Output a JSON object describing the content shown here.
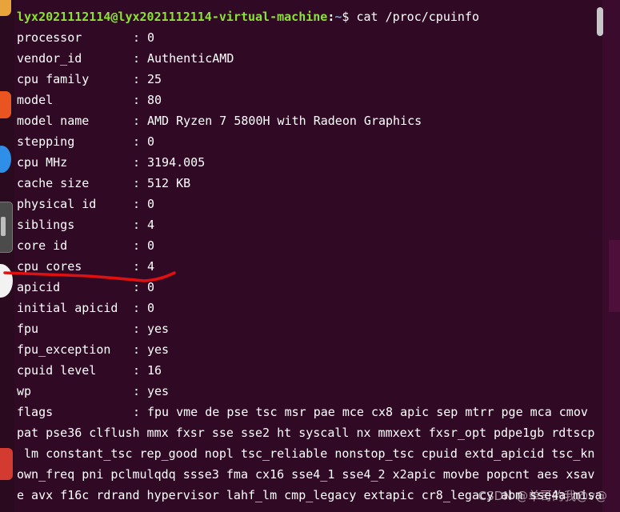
{
  "prompt": {
    "user_host": "lyx2021112114@lyx2021112114-virtual-machine",
    "sep": ":",
    "path": "~",
    "dollar": "$",
    "command": "cat /proc/cpuinfo"
  },
  "fields": [
    {
      "key": "processor",
      "value": "0"
    },
    {
      "key": "vendor_id",
      "value": "AuthenticAMD"
    },
    {
      "key": "cpu family",
      "value": "25"
    },
    {
      "key": "model",
      "value": "80"
    },
    {
      "key": "model name",
      "value": "AMD Ryzen 7 5800H with Radeon Graphics"
    },
    {
      "key": "stepping",
      "value": "0"
    },
    {
      "key": "cpu MHz",
      "value": "3194.005"
    },
    {
      "key": "cache size",
      "value": "512 KB"
    },
    {
      "key": "physical id",
      "value": "0"
    },
    {
      "key": "siblings",
      "value": "4"
    },
    {
      "key": "core id",
      "value": "0"
    },
    {
      "key": "cpu cores",
      "value": "4"
    },
    {
      "key": "apicid",
      "value": "0"
    },
    {
      "key": "initial apicid",
      "value": "0"
    },
    {
      "key": "fpu",
      "value": "yes"
    },
    {
      "key": "fpu_exception",
      "value": "yes"
    },
    {
      "key": "cpuid level",
      "value": "16"
    },
    {
      "key": "wp",
      "value": "yes"
    },
    {
      "key": "flags",
      "value": "fpu vme de pse tsc msr pae mce cx8 apic sep mtrr pge mca cmov"
    }
  ],
  "flags_wrap": [
    "pat pse36 clflush mmx fxsr sse sse2 ht syscall nx mmxext fxsr_opt pdpe1gb rdtscp",
    " lm constant_tsc rep_good nopl tsc_reliable nonstop_tsc cpuid extd_apicid tsc_kn",
    "own_freq pni pclmulqdq ssse3 fma cx16 sse4_1 sse4_2 x2apic movbe popcnt aes xsav",
    "e avx f16c rdrand hypervisor lahf_lm cmp_legacy extapic cr8_legacy abm sse4a misa"
  ],
  "watermark": "CSDN @单哥的我@v@",
  "colors": {
    "background": "#300a24",
    "prompt_user": "#8ae234",
    "prompt_path": "#729fcf",
    "annotation_red": "#e01010"
  }
}
